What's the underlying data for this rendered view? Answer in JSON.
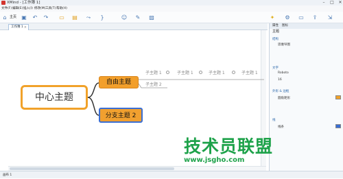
{
  "window": {
    "title": "XMind - [工作簿 1]",
    "controls": {
      "minimize": "–",
      "maximize": "□",
      "close": "✕"
    }
  },
  "menu": [
    "文件(F)",
    "编辑(E)",
    "插入(I)",
    "修改(M)",
    "工具(T)",
    "帮助(H)"
  ],
  "toolbar": {
    "home_label": "主页"
  },
  "tabs": [
    {
      "label": "工作簿 1"
    }
  ],
  "panel": {
    "tabs": [
      "属性",
      "图标"
    ],
    "title": "主题",
    "sections": {
      "structure": "结构",
      "structure_value": "思维导图",
      "text": "文字",
      "font": "Roboto",
      "font_size": "16",
      "shape": "外形 & 边框",
      "shape_value": "圆角矩形",
      "line": "线",
      "line_value": "线条"
    },
    "colors": {
      "accent": "#f1a22a",
      "blue": "#3a6ed3"
    }
  },
  "map": {
    "central": "中心主题",
    "topic_free": "自由主题",
    "topic_branch": "分支主题 2",
    "subtopics_row": [
      "子主题 1",
      "子主题 1",
      "子主题 1",
      "子主题 1"
    ],
    "subtopic_below": "子主题 2"
  },
  "status": {
    "left": "画布 1"
  },
  "watermark": {
    "text": "技术员联盟",
    "url": "www.jsgho.com"
  }
}
